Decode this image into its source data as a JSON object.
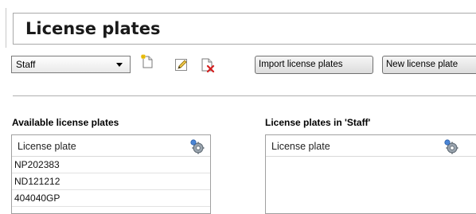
{
  "header": {
    "title": "License plates"
  },
  "toolbar": {
    "group_select_value": "Staff",
    "new_icon": "new-item-icon",
    "edit_icon": "edit-icon",
    "delete_icon": "delete-icon",
    "import_label": "Import license plates",
    "new_label": "New license plate"
  },
  "available": {
    "title": "Available license plates",
    "column_header": "License plate",
    "column_icon": "column-settings-icon",
    "rows": [
      "NP202383",
      "ND121212",
      "404040GP"
    ]
  },
  "group": {
    "title": "License plates in 'Staff'",
    "column_header": "License plate",
    "column_icon": "column-settings-icon",
    "rows": []
  }
}
